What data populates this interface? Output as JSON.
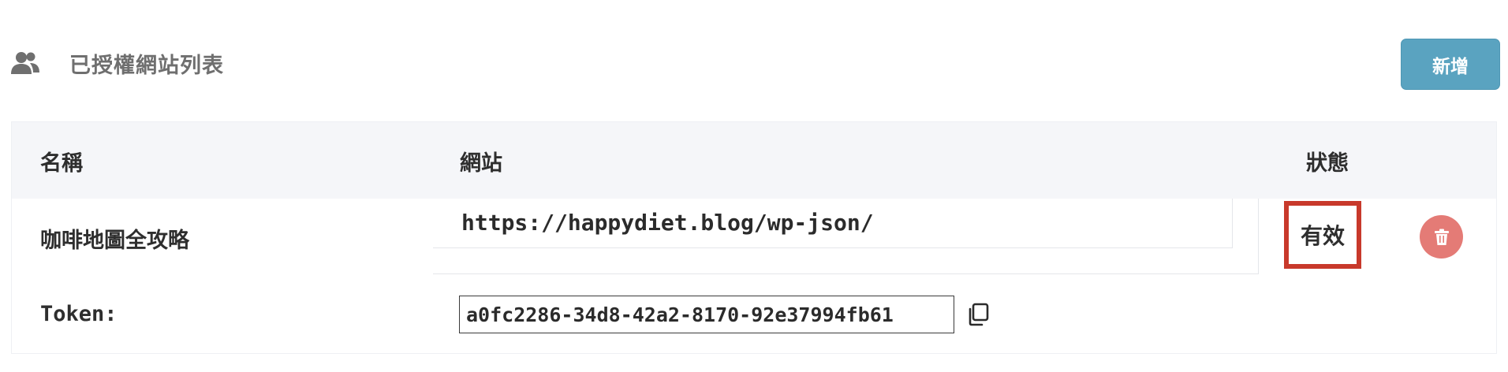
{
  "header": {
    "title": "已授權網站列表",
    "icon": "users-icon",
    "add_label": "新增",
    "add_color": "#5aa3c0"
  },
  "table": {
    "columns": {
      "name": "名稱",
      "site": "網站",
      "status": "狀態"
    },
    "row": {
      "name": "咖啡地圖全攻略",
      "url": "https://happydiet.blog/wp-json/",
      "status": "有效",
      "status_highlight_color": "#c8392b",
      "token_label": "Token:",
      "token_value": "a0fc2286-34d8-42a2-8170-92e37994fb61",
      "delete_icon": "trash-icon",
      "delete_color": "#e47b76",
      "copy_icon": "copy-icon"
    }
  }
}
